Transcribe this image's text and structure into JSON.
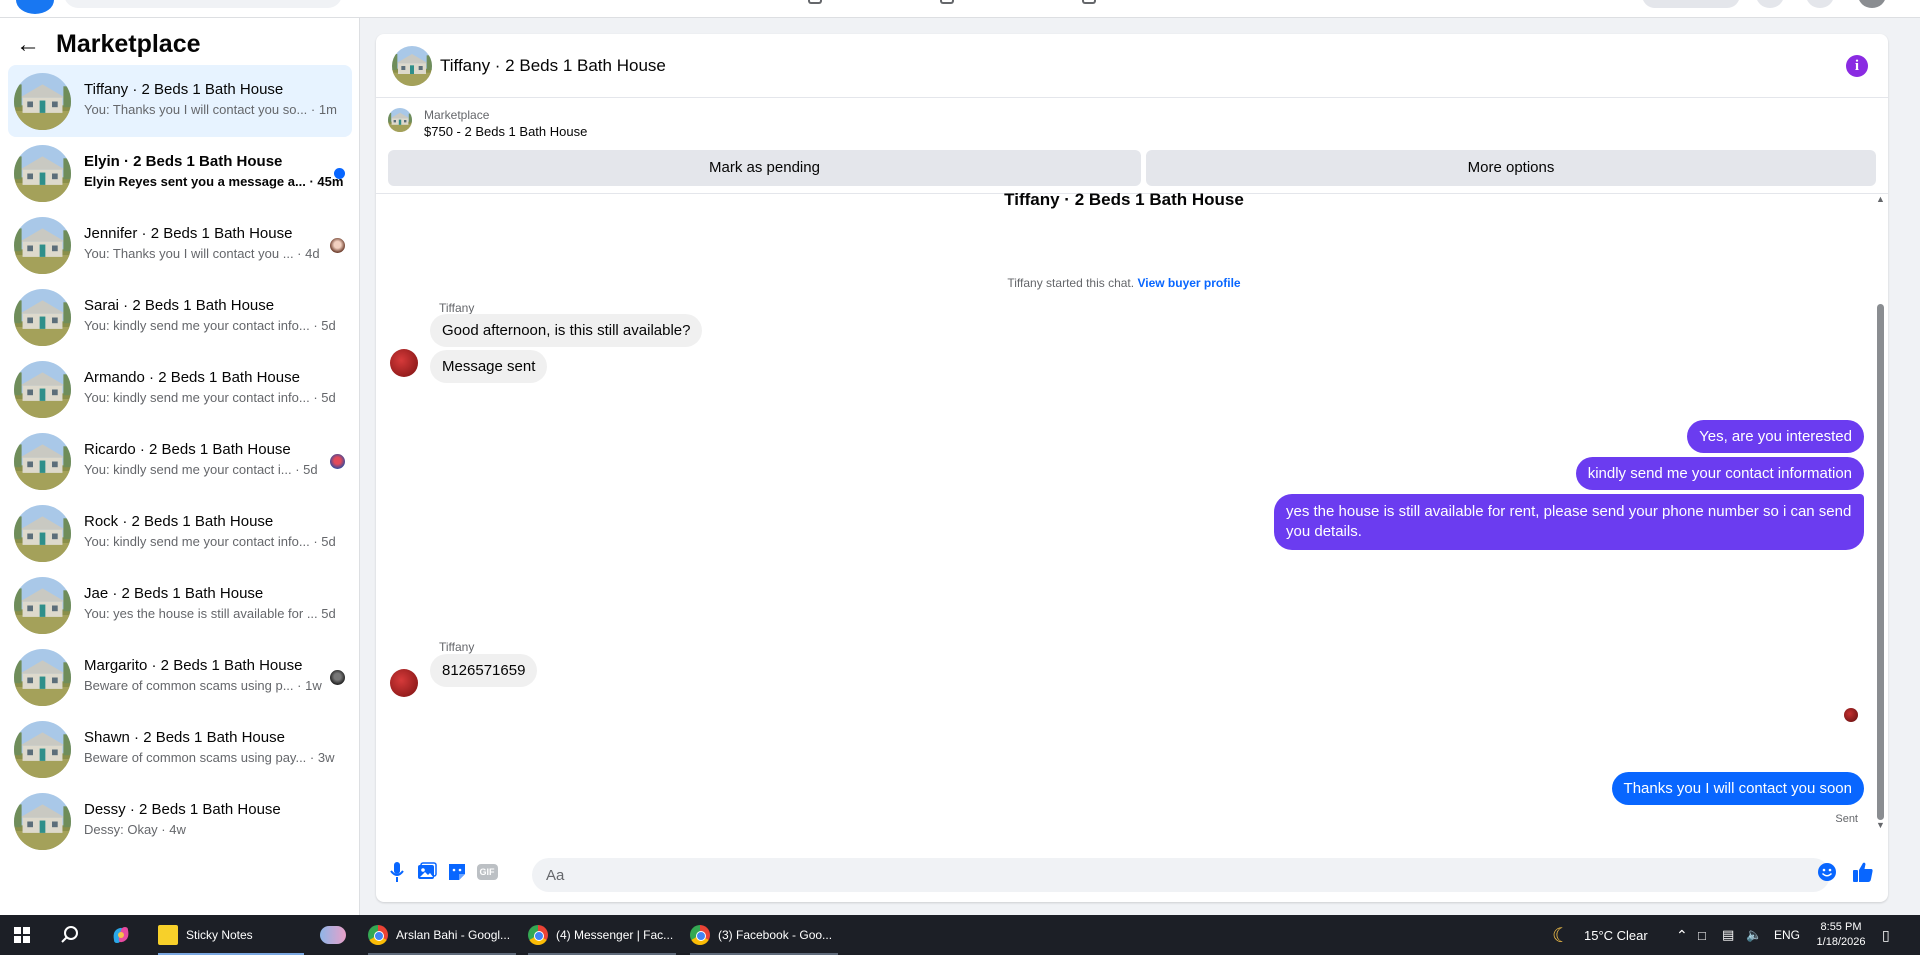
{
  "sidebar": {
    "title": "Marketplace",
    "conversations": [
      {
        "title": "Tiffany · 2 Beds 1 Bath House",
        "preview": "You: Thanks you I will contact you so... · 1m",
        "active": true,
        "unread": false,
        "indicator": "none"
      },
      {
        "title": "Elyin · 2 Beds 1 Bath House",
        "preview": "Elyin Reyes sent you a message a... · 45m",
        "active": false,
        "unread": true,
        "indicator": "dot"
      },
      {
        "title": "Jennifer · 2 Beds 1 Bath House",
        "preview": "You: Thanks you I will contact you ... · 4d",
        "active": false,
        "unread": false,
        "indicator": "avatar"
      },
      {
        "title": "Sarai · 2 Beds 1 Bath House",
        "preview": "You: kindly send me your contact info... · 5d",
        "active": false,
        "unread": false,
        "indicator": "none"
      },
      {
        "title": "Armando · 2 Beds 1 Bath House",
        "preview": "You: kindly send me your contact info... · 5d",
        "active": false,
        "unread": false,
        "indicator": "none"
      },
      {
        "title": "Ricardo · 2 Beds 1 Bath House",
        "preview": "You: kindly send me your contact i... · 5d",
        "active": false,
        "unread": false,
        "indicator": "avatar"
      },
      {
        "title": "Rock · 2 Beds 1 Bath House",
        "preview": "You: kindly send me your contact info... · 5d",
        "active": false,
        "unread": false,
        "indicator": "none"
      },
      {
        "title": "Jae · 2 Beds 1 Bath House",
        "preview": "You: yes the house is still available for ... 5d",
        "active": false,
        "unread": false,
        "indicator": "none"
      },
      {
        "title": "Margarito · 2 Beds 1 Bath House",
        "preview": "Beware of common scams using p... · 1w",
        "active": false,
        "unread": false,
        "indicator": "avatar"
      },
      {
        "title": "Shawn · 2 Beds 1 Bath House",
        "preview": "Beware of common scams using pay... · 3w",
        "active": false,
        "unread": false,
        "indicator": "none"
      },
      {
        "title": "Dessy · 2 Beds 1 Bath House",
        "preview": "Dessy: Okay · 4w",
        "active": false,
        "unread": false,
        "indicator": "none"
      }
    ]
  },
  "chat": {
    "title": "Tiffany · 2 Beds 1 Bath House",
    "listing": {
      "source": "Marketplace",
      "price_title": "$750 - 2 Beds 1 Bath House",
      "mark_pending": "Mark as pending",
      "more_options": "More options"
    },
    "thread_title": "Tiffany · 2 Beds 1 Bath House",
    "started_text": "Tiffany started this chat.",
    "view_profile": "View buyer profile",
    "messages": {
      "sender_1": "Tiffany",
      "in_1": "Good afternoon, is this still available?",
      "in_2": "Message sent",
      "out_1": "Yes, are you interested",
      "out_2": "kindly send me your contact information",
      "out_3": "yes the house is still available for rent, please send your phone number so i can send you details.",
      "sender_2": "Tiffany",
      "in_3": "8126571659",
      "out_4": "Thanks you I will contact you soon",
      "status": "Sent"
    },
    "composer": {
      "placeholder": "Aa",
      "gif_label": "GIF"
    }
  },
  "taskbar": {
    "apps": [
      {
        "label": "Sticky Notes"
      },
      {
        "label": "Arslan Bahi - Googl..."
      },
      {
        "label": "(4) Messenger | Fac..."
      },
      {
        "label": "(3) Facebook - Goo..."
      }
    ],
    "weather": "15°C  Clear",
    "language": "ENG",
    "time": "8:55 PM",
    "date": "1/18/2026"
  },
  "colors": {
    "accent_blue": "#0866ff",
    "outgoing_purple": "#6b3cf0",
    "active_conv_bg": "#e7f3ff"
  }
}
